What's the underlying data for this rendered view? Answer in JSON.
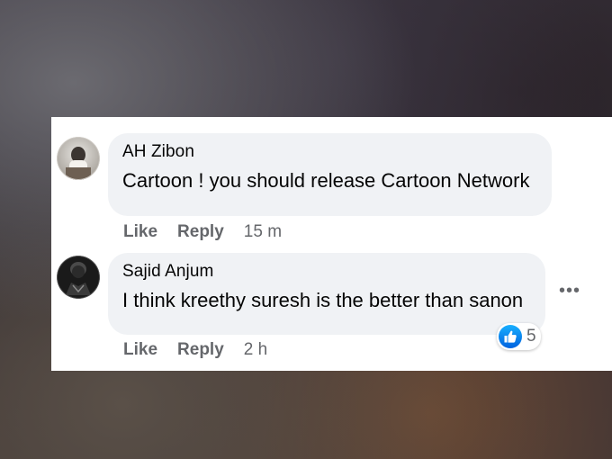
{
  "comments": [
    {
      "author": "AH Zibon",
      "text": "Cartoon ! you should release Cartoon Network",
      "like_label": "Like",
      "reply_label": "Reply",
      "time": "15 m",
      "avatar_icon": "profile-photo"
    },
    {
      "author": "Sajid Anjum",
      "text": "I think kreethy suresh is the better than sanon",
      "like_label": "Like",
      "reply_label": "Reply",
      "time": "2 h",
      "avatar_icon": "profile-photo",
      "more_icon": "more-options-icon",
      "reaction": {
        "icon": "thumbs-up-icon",
        "count": "5",
        "color": "#1877f2"
      }
    }
  ],
  "colors": {
    "bubble_bg": "#f0f2f5",
    "meta_text": "#65676b",
    "primary_text": "#050505",
    "like_blue": "#1877f2"
  }
}
